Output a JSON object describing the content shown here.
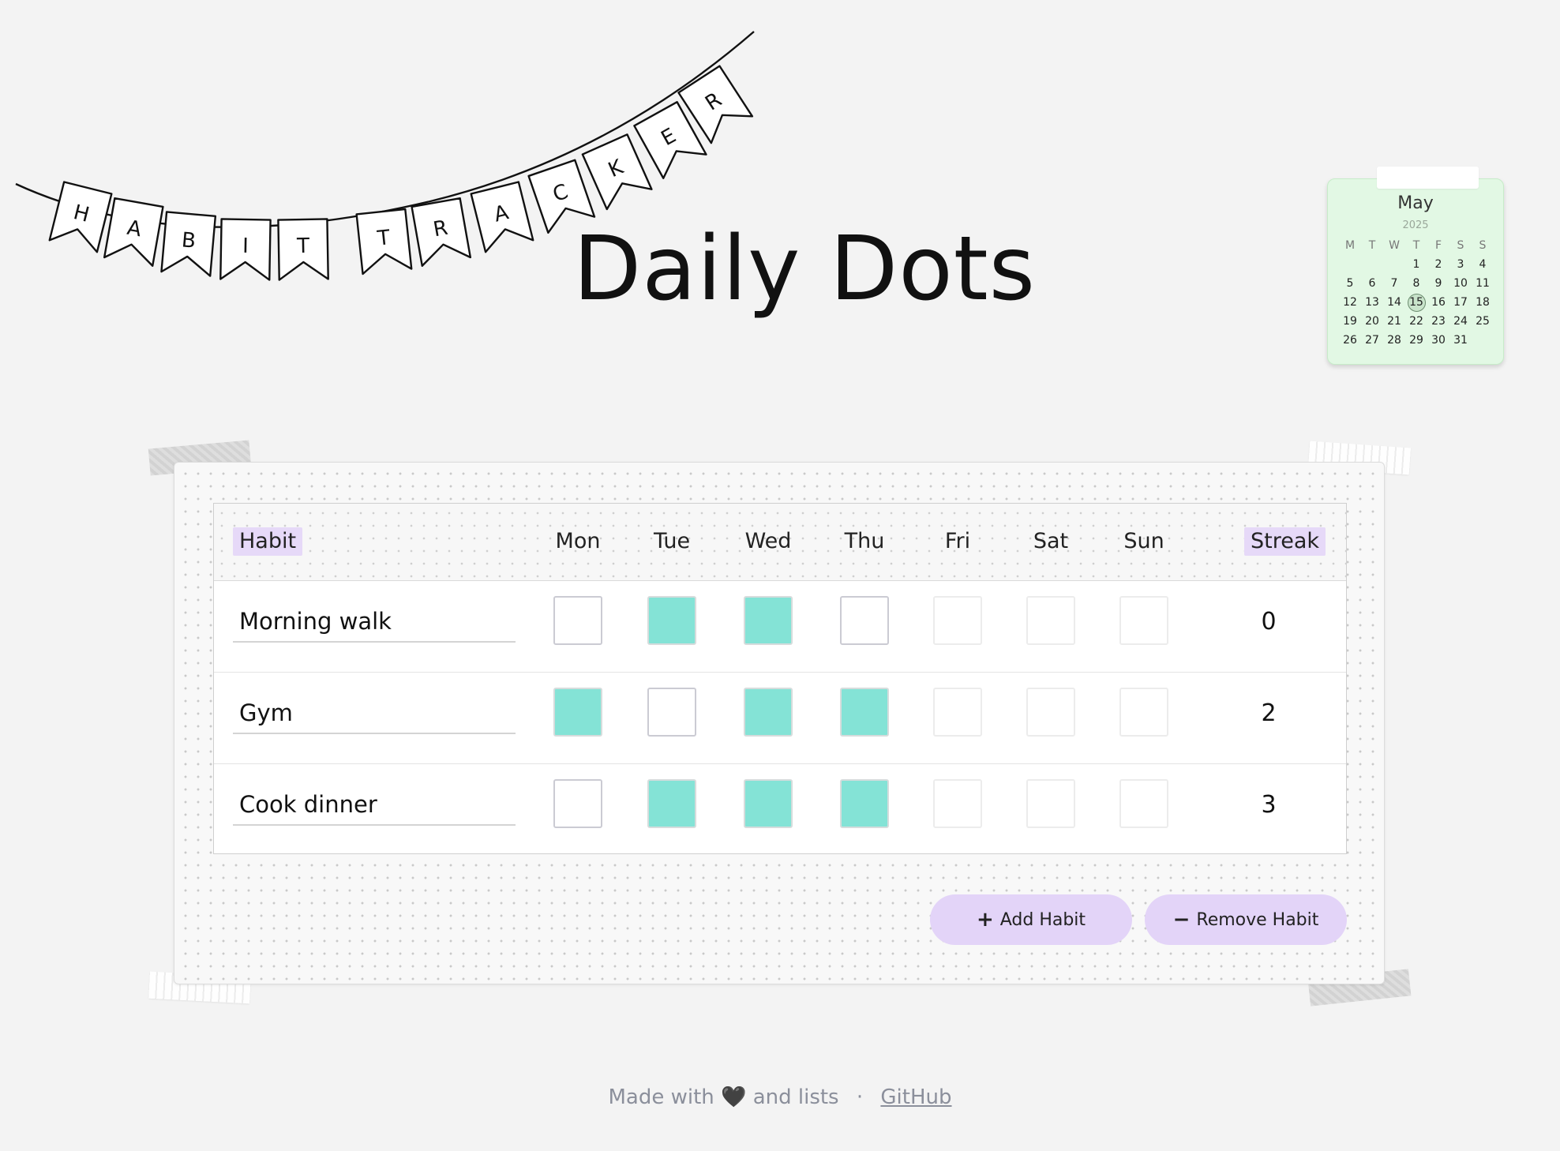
{
  "banner": {
    "letters": [
      "H",
      "A",
      "B",
      "I",
      "T",
      "T",
      "R",
      "A",
      "C",
      "K",
      "E",
      "R"
    ]
  },
  "title": "Daily Dots",
  "calendar": {
    "month": "May",
    "year": "2025",
    "weekday_headers": [
      "M",
      "T",
      "W",
      "T",
      "F",
      "S",
      "S"
    ],
    "leading_blanks": 3,
    "days_in_month": 31,
    "today": "15"
  },
  "table": {
    "habit_header": "Habit",
    "day_headers": [
      "Mon",
      "Tue",
      "Wed",
      "Thu",
      "Fri",
      "Sat",
      "Sun"
    ],
    "streak_header": "Streak",
    "today_index": 3,
    "rows": [
      {
        "name": "Morning walk",
        "checks": [
          false,
          true,
          true,
          false,
          false,
          false,
          false
        ],
        "streak": "0"
      },
      {
        "name": "Gym",
        "checks": [
          true,
          false,
          true,
          true,
          false,
          false,
          false
        ],
        "streak": "2"
      },
      {
        "name": "Cook dinner",
        "checks": [
          false,
          true,
          true,
          true,
          false,
          false,
          false
        ],
        "streak": "3"
      }
    ]
  },
  "actions": {
    "add_icon": "+",
    "add_label": "Add Habit",
    "remove_icon": "−",
    "remove_label": "Remove Habit"
  },
  "footer": {
    "made_with": "Made with",
    "heart": "🖤",
    "and_lists": "and lists",
    "separator": "·",
    "github": "GitHub"
  },
  "colors": {
    "checked": "#84e3d6",
    "accent_purple": "#e3d4f8",
    "calendar_bg": "#e2f8e4",
    "page_bg": "#f3f3f3"
  }
}
